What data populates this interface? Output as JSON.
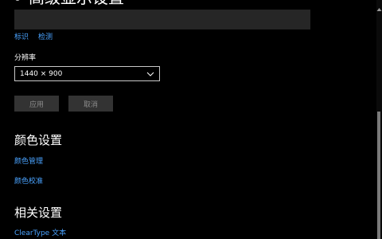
{
  "header": {
    "title": "高级显示设置",
    "icon": "gear-icon"
  },
  "display": {
    "links": [
      "标识",
      "检测"
    ]
  },
  "resolution": {
    "label": "分辨率",
    "selected_value": "1440 × 900"
  },
  "buttons": {
    "apply_label": "应用",
    "cancel_label": "取消"
  },
  "color_settings": {
    "heading": "颜色设置",
    "links": [
      "颜色管理",
      "颜色校准"
    ]
  },
  "related_settings": {
    "heading": "相关设置",
    "links": [
      "ClearType 文本"
    ]
  },
  "colors": {
    "background": "#000000",
    "accent": "#4aa3ff",
    "panel": "#262626",
    "button_disabled": "#333333"
  }
}
